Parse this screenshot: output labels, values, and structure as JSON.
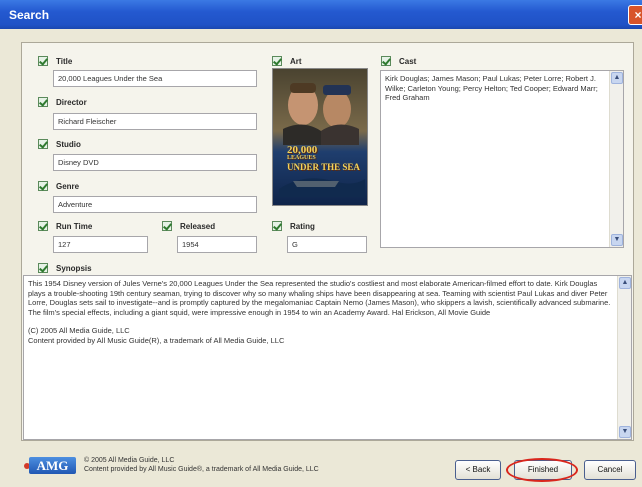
{
  "window": {
    "title": "Search",
    "close_glyph": "×"
  },
  "fields": {
    "title": {
      "label": "Title",
      "value": "20,000 Leagues Under the Sea"
    },
    "director": {
      "label": "Director",
      "value": "Richard Fleischer"
    },
    "studio": {
      "label": "Studio",
      "value": "Disney DVD"
    },
    "genre": {
      "label": "Genre",
      "value": "Adventure"
    },
    "runtime": {
      "label": "Run Time",
      "value": "127"
    },
    "released": {
      "label": "Released",
      "value": "1954"
    },
    "rating": {
      "label": "Rating",
      "value": "G"
    },
    "art": {
      "label": "Art",
      "poster_title_line1": "20,000",
      "poster_title_line2": "LEAGUES",
      "poster_title_line3": "UNDER THE SEA"
    },
    "cast": {
      "label": "Cast",
      "value": "Kirk Douglas; James Mason; Paul Lukas; Peter Lorre; Robert J. Wilke; Carleton Young; Percy Helton; Ted Cooper; Edward Marr; Fred Graham"
    },
    "synopsis": {
      "label": "Synopsis",
      "paragraph": "This 1954 Disney version of Jules Verne's 20,000 Leagues Under the Sea represented the studio's costliest and most elaborate American-filmed effort to date. Kirk Douglas plays a trouble-shooting 19th century seaman, trying to discover why so many whaling ships have been disappearing at sea. Teaming with scientist Paul Lukas and diver Peter Lorre, Douglas sets sail to investigate--and is promptly captured by the megalomaniac Captain Nemo (James Mason), who skippers a lavish, scientifically advanced submarine. The film's special effects, including a giant squid, were impressive enough in 1954 to win an Academy Award. Hal Erickson, All Movie Guide",
      "copyright": "(C) 2005 All Media Guide, LLC",
      "credit": "Content provided by All Music Guide(R), a trademark of All Media Guide, LLC"
    }
  },
  "footer": {
    "logo": "AMG",
    "line1": "© 2005 All Media Guide, LLC",
    "line2": "Content provided by All Music Guide®, a trademark of All Media Guide, LLC"
  },
  "buttons": {
    "back": "< Back",
    "finished": "Finished",
    "cancel": "Cancel"
  },
  "colors": {
    "titlebar": "#2459d0",
    "highlight": "#d9261c",
    "check": "#2f7a2f"
  },
  "icons": {
    "checkbox": "checkmark-icon",
    "close": "close-icon",
    "scroll_up": "scroll-up-icon",
    "scroll_down": "scroll-down-icon"
  }
}
